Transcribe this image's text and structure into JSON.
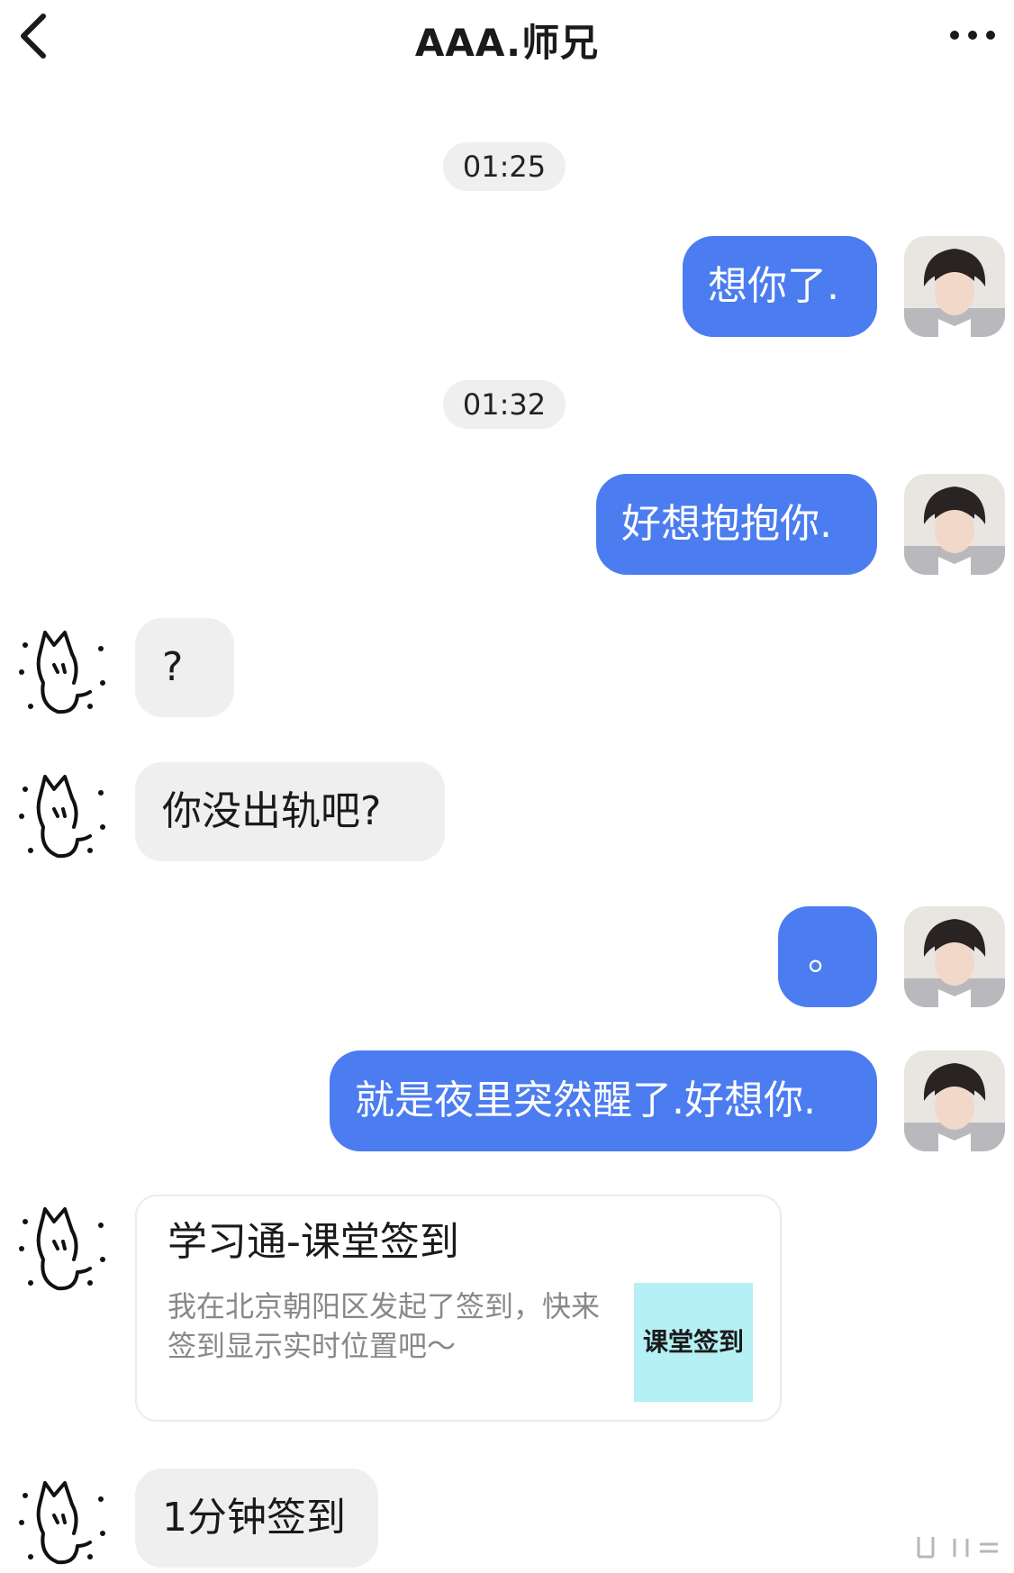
{
  "header": {
    "title": "AAA.师兄",
    "back_icon": "back-chevron-icon",
    "more_icon": "more-dots-icon"
  },
  "messages": [
    {
      "type": "time",
      "text": "01:25"
    },
    {
      "type": "out",
      "text": "想你了."
    },
    {
      "type": "time",
      "text": "01:32"
    },
    {
      "type": "out",
      "text": "好想抱抱你."
    },
    {
      "type": "in",
      "text": "?"
    },
    {
      "type": "in",
      "text": "你没出轨吧?"
    },
    {
      "type": "out",
      "text": "。"
    },
    {
      "type": "out",
      "text": "就是夜里突然醒了.好想你."
    },
    {
      "type": "card",
      "title": "学习通-课堂签到",
      "description": "我在北京朝阳区发起了签到，快来签到显示实时位置吧～",
      "thumb_label": "课堂签到",
      "thumb_color": "#b5f0f5"
    },
    {
      "type": "in",
      "text": "1分钟签到"
    }
  ],
  "colors": {
    "outgoing_bubble": "#4b7cf0",
    "incoming_bubble": "#efefef",
    "time_pill": "#efefef"
  },
  "avatars": {
    "me": "user-photo-avatar",
    "them": "doodle-cat-avatar"
  }
}
